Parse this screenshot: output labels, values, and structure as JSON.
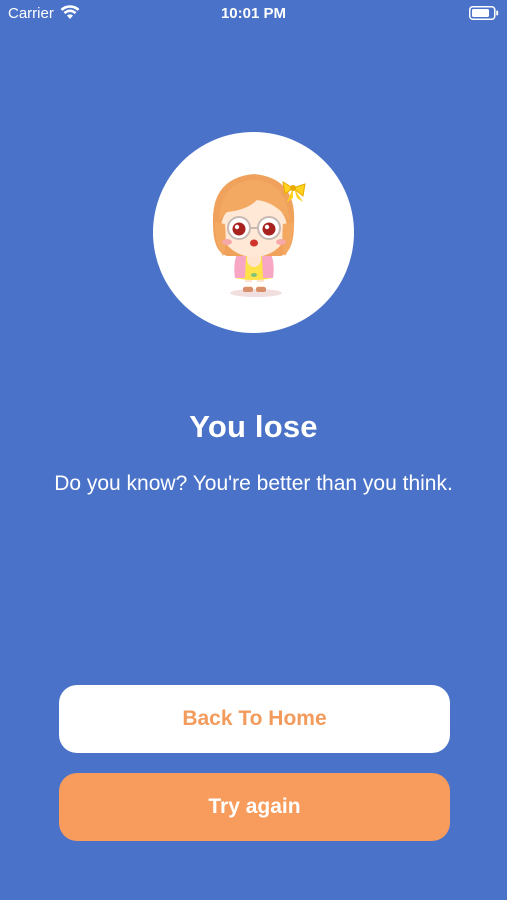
{
  "status_bar": {
    "carrier": "Carrier",
    "time": "10:01 PM",
    "wifi_icon": "wifi-icon",
    "battery_icon": "battery-icon"
  },
  "avatar": {
    "icon": "girl-character-illustration"
  },
  "result": {
    "title": "You lose",
    "message": "Do you know? You're better than you think."
  },
  "buttons": {
    "back_home": "Back To Home",
    "try_again": "Try again"
  },
  "colors": {
    "background": "#4a72c8",
    "accent": "#f79c5c",
    "white": "#ffffff"
  }
}
